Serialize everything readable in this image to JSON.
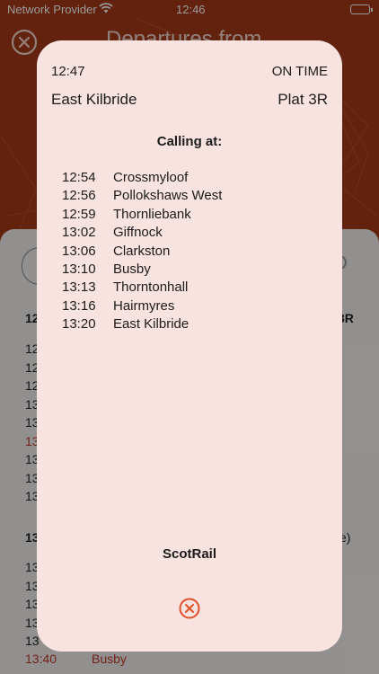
{
  "status_bar": {
    "carrier": "Network Provider",
    "time": "12:46",
    "wifi_icon": "wifi-icon",
    "battery_level": 1.0
  },
  "background": {
    "title": "Departures from",
    "section1_header_left": "12",
    "section1_header_right": "3R",
    "section1_rows": [
      "12",
      "12",
      "12",
      "13",
      "13",
      "13",
      "13",
      "13",
      "13"
    ],
    "section1_red_row_index": 5,
    "section2_header_left": "13",
    "section2_header_right": "e)",
    "section2_rows": [
      "13",
      "13",
      "13",
      "13",
      "13"
    ],
    "section2_last_time": "13:40",
    "section2_last_dest": "Busby",
    "accent_color": "#a33a16",
    "late_color": "#c0392b"
  },
  "modal": {
    "departure_time": "12:47",
    "status": "ON TIME",
    "destination": "East Kilbride",
    "platform": "Plat 3R",
    "calling_label": "Calling at:",
    "stops": [
      {
        "time": "12:54",
        "name": "Crossmyloof"
      },
      {
        "time": "12:56",
        "name": "Pollokshaws West"
      },
      {
        "time": "12:59",
        "name": "Thornliebank"
      },
      {
        "time": "13:02",
        "name": "Giffnock"
      },
      {
        "time": "13:06",
        "name": "Clarkston"
      },
      {
        "time": "13:10",
        "name": "Busby"
      },
      {
        "time": "13:13",
        "name": "Thorntonhall"
      },
      {
        "time": "13:16",
        "name": "Hairmyres"
      },
      {
        "time": "13:20",
        "name": "East Kilbride"
      }
    ],
    "operator": "ScotRail",
    "close_icon": "close-circle-icon",
    "close_color": "#e0502a"
  }
}
